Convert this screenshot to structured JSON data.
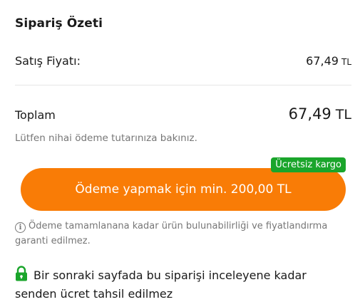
{
  "summary": {
    "title": "Sipariş Özeti",
    "sale_label": "Satış Fiyatı:",
    "sale_amount": "67,49",
    "sale_currency": "TL",
    "total_label": "Toplam",
    "total_amount": "67,49",
    "total_currency": "TL",
    "hint": "Lütfen nihai ödeme tutarınıza bakınız."
  },
  "payment": {
    "badge": "Ücretsiz kargo",
    "button_label": "Ödeme yapmak için min. 200,00 TL",
    "button_color": "#f97c06",
    "badge_color": "#1aa52b"
  },
  "notes": {
    "info_icon": "info-icon",
    "info_text": "Ödeme tamamlanana kadar ürün bulunabilirliği ve fiyatlandırma garanti edilmez.",
    "lock_icon": "lock-icon",
    "secure_text": "Bir sonraki sayfada bu siparişi inceleyene kadar senden ücret tahsil edilmez"
  }
}
